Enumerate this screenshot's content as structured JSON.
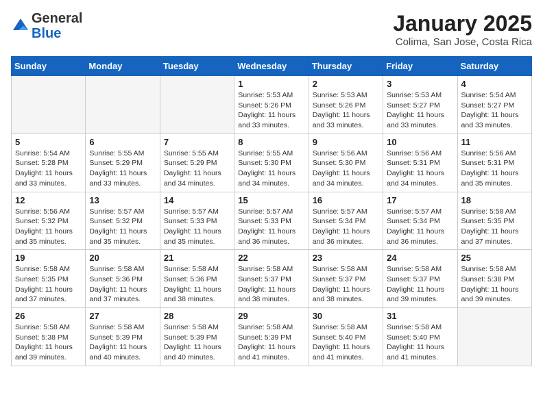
{
  "header": {
    "logo_general": "General",
    "logo_blue": "Blue",
    "month_title": "January 2025",
    "location": "Colima, San Jose, Costa Rica"
  },
  "weekdays": [
    "Sunday",
    "Monday",
    "Tuesday",
    "Wednesday",
    "Thursday",
    "Friday",
    "Saturday"
  ],
  "weeks": [
    [
      {
        "day": "",
        "sunrise": "",
        "sunset": "",
        "daylight": ""
      },
      {
        "day": "",
        "sunrise": "",
        "sunset": "",
        "daylight": ""
      },
      {
        "day": "",
        "sunrise": "",
        "sunset": "",
        "daylight": ""
      },
      {
        "day": "1",
        "sunrise": "Sunrise: 5:53 AM",
        "sunset": "Sunset: 5:26 PM",
        "daylight": "Daylight: 11 hours and 33 minutes."
      },
      {
        "day": "2",
        "sunrise": "Sunrise: 5:53 AM",
        "sunset": "Sunset: 5:26 PM",
        "daylight": "Daylight: 11 hours and 33 minutes."
      },
      {
        "day": "3",
        "sunrise": "Sunrise: 5:53 AM",
        "sunset": "Sunset: 5:27 PM",
        "daylight": "Daylight: 11 hours and 33 minutes."
      },
      {
        "day": "4",
        "sunrise": "Sunrise: 5:54 AM",
        "sunset": "Sunset: 5:27 PM",
        "daylight": "Daylight: 11 hours and 33 minutes."
      }
    ],
    [
      {
        "day": "5",
        "sunrise": "Sunrise: 5:54 AM",
        "sunset": "Sunset: 5:28 PM",
        "daylight": "Daylight: 11 hours and 33 minutes."
      },
      {
        "day": "6",
        "sunrise": "Sunrise: 5:55 AM",
        "sunset": "Sunset: 5:29 PM",
        "daylight": "Daylight: 11 hours and 33 minutes."
      },
      {
        "day": "7",
        "sunrise": "Sunrise: 5:55 AM",
        "sunset": "Sunset: 5:29 PM",
        "daylight": "Daylight: 11 hours and 34 minutes."
      },
      {
        "day": "8",
        "sunrise": "Sunrise: 5:55 AM",
        "sunset": "Sunset: 5:30 PM",
        "daylight": "Daylight: 11 hours and 34 minutes."
      },
      {
        "day": "9",
        "sunrise": "Sunrise: 5:56 AM",
        "sunset": "Sunset: 5:30 PM",
        "daylight": "Daylight: 11 hours and 34 minutes."
      },
      {
        "day": "10",
        "sunrise": "Sunrise: 5:56 AM",
        "sunset": "Sunset: 5:31 PM",
        "daylight": "Daylight: 11 hours and 34 minutes."
      },
      {
        "day": "11",
        "sunrise": "Sunrise: 5:56 AM",
        "sunset": "Sunset: 5:31 PM",
        "daylight": "Daylight: 11 hours and 35 minutes."
      }
    ],
    [
      {
        "day": "12",
        "sunrise": "Sunrise: 5:56 AM",
        "sunset": "Sunset: 5:32 PM",
        "daylight": "Daylight: 11 hours and 35 minutes."
      },
      {
        "day": "13",
        "sunrise": "Sunrise: 5:57 AM",
        "sunset": "Sunset: 5:32 PM",
        "daylight": "Daylight: 11 hours and 35 minutes."
      },
      {
        "day": "14",
        "sunrise": "Sunrise: 5:57 AM",
        "sunset": "Sunset: 5:33 PM",
        "daylight": "Daylight: 11 hours and 35 minutes."
      },
      {
        "day": "15",
        "sunrise": "Sunrise: 5:57 AM",
        "sunset": "Sunset: 5:33 PM",
        "daylight": "Daylight: 11 hours and 36 minutes."
      },
      {
        "day": "16",
        "sunrise": "Sunrise: 5:57 AM",
        "sunset": "Sunset: 5:34 PM",
        "daylight": "Daylight: 11 hours and 36 minutes."
      },
      {
        "day": "17",
        "sunrise": "Sunrise: 5:57 AM",
        "sunset": "Sunset: 5:34 PM",
        "daylight": "Daylight: 11 hours and 36 minutes."
      },
      {
        "day": "18",
        "sunrise": "Sunrise: 5:58 AM",
        "sunset": "Sunset: 5:35 PM",
        "daylight": "Daylight: 11 hours and 37 minutes."
      }
    ],
    [
      {
        "day": "19",
        "sunrise": "Sunrise: 5:58 AM",
        "sunset": "Sunset: 5:35 PM",
        "daylight": "Daylight: 11 hours and 37 minutes."
      },
      {
        "day": "20",
        "sunrise": "Sunrise: 5:58 AM",
        "sunset": "Sunset: 5:36 PM",
        "daylight": "Daylight: 11 hours and 37 minutes."
      },
      {
        "day": "21",
        "sunrise": "Sunrise: 5:58 AM",
        "sunset": "Sunset: 5:36 PM",
        "daylight": "Daylight: 11 hours and 38 minutes."
      },
      {
        "day": "22",
        "sunrise": "Sunrise: 5:58 AM",
        "sunset": "Sunset: 5:37 PM",
        "daylight": "Daylight: 11 hours and 38 minutes."
      },
      {
        "day": "23",
        "sunrise": "Sunrise: 5:58 AM",
        "sunset": "Sunset: 5:37 PM",
        "daylight": "Daylight: 11 hours and 38 minutes."
      },
      {
        "day": "24",
        "sunrise": "Sunrise: 5:58 AM",
        "sunset": "Sunset: 5:37 PM",
        "daylight": "Daylight: 11 hours and 39 minutes."
      },
      {
        "day": "25",
        "sunrise": "Sunrise: 5:58 AM",
        "sunset": "Sunset: 5:38 PM",
        "daylight": "Daylight: 11 hours and 39 minutes."
      }
    ],
    [
      {
        "day": "26",
        "sunrise": "Sunrise: 5:58 AM",
        "sunset": "Sunset: 5:38 PM",
        "daylight": "Daylight: 11 hours and 39 minutes."
      },
      {
        "day": "27",
        "sunrise": "Sunrise: 5:58 AM",
        "sunset": "Sunset: 5:39 PM",
        "daylight": "Daylight: 11 hours and 40 minutes."
      },
      {
        "day": "28",
        "sunrise": "Sunrise: 5:58 AM",
        "sunset": "Sunset: 5:39 PM",
        "daylight": "Daylight: 11 hours and 40 minutes."
      },
      {
        "day": "29",
        "sunrise": "Sunrise: 5:58 AM",
        "sunset": "Sunset: 5:39 PM",
        "daylight": "Daylight: 11 hours and 41 minutes."
      },
      {
        "day": "30",
        "sunrise": "Sunrise: 5:58 AM",
        "sunset": "Sunset: 5:40 PM",
        "daylight": "Daylight: 11 hours and 41 minutes."
      },
      {
        "day": "31",
        "sunrise": "Sunrise: 5:58 AM",
        "sunset": "Sunset: 5:40 PM",
        "daylight": "Daylight: 11 hours and 41 minutes."
      },
      {
        "day": "",
        "sunrise": "",
        "sunset": "",
        "daylight": ""
      }
    ]
  ]
}
